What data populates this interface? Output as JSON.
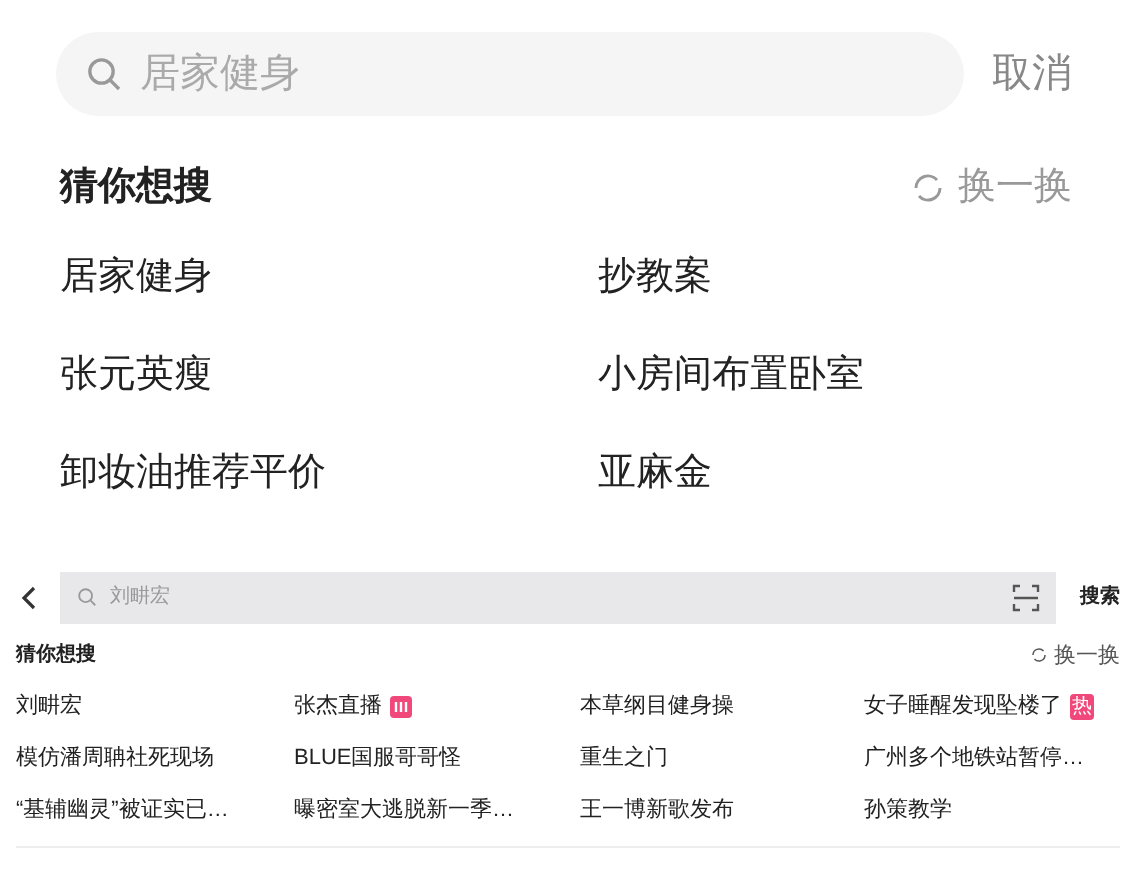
{
  "top_panel": {
    "search": {
      "placeholder": "居家健身"
    },
    "cancel": "取消",
    "section_title": "猜你想搜",
    "refresh": "换一换",
    "items": [
      {
        "text": "居家健身"
      },
      {
        "text": "抄教案"
      },
      {
        "text": "张元英瘦"
      },
      {
        "text": "小房间布置卧室"
      },
      {
        "text": "卸妆油推荐平价"
      },
      {
        "text": "亚麻金"
      }
    ]
  },
  "bottom_panel": {
    "search": {
      "placeholder": "刘畊宏"
    },
    "search_button": "搜索",
    "section_title": "猜你想搜",
    "refresh": "换一换",
    "items": [
      {
        "text": "刘畊宏"
      },
      {
        "text": "张杰直播",
        "badge": {
          "kind": "live"
        }
      },
      {
        "text": "本草纲目健身操"
      },
      {
        "text": "女子睡醒发现坠楼了",
        "badge": {
          "kind": "label",
          "text": "热"
        }
      },
      {
        "text": "模仿潘周聃社死现场"
      },
      {
        "text": "BLUE国服哥哥怪"
      },
      {
        "text": "重生之门"
      },
      {
        "text": "广州多个地铁站暂停…"
      },
      {
        "text": "“基辅幽灵”被证实已…"
      },
      {
        "text": "曝密室大逃脱新一季…"
      },
      {
        "text": "王一博新歌发布"
      },
      {
        "text": "孙策教学"
      }
    ]
  }
}
